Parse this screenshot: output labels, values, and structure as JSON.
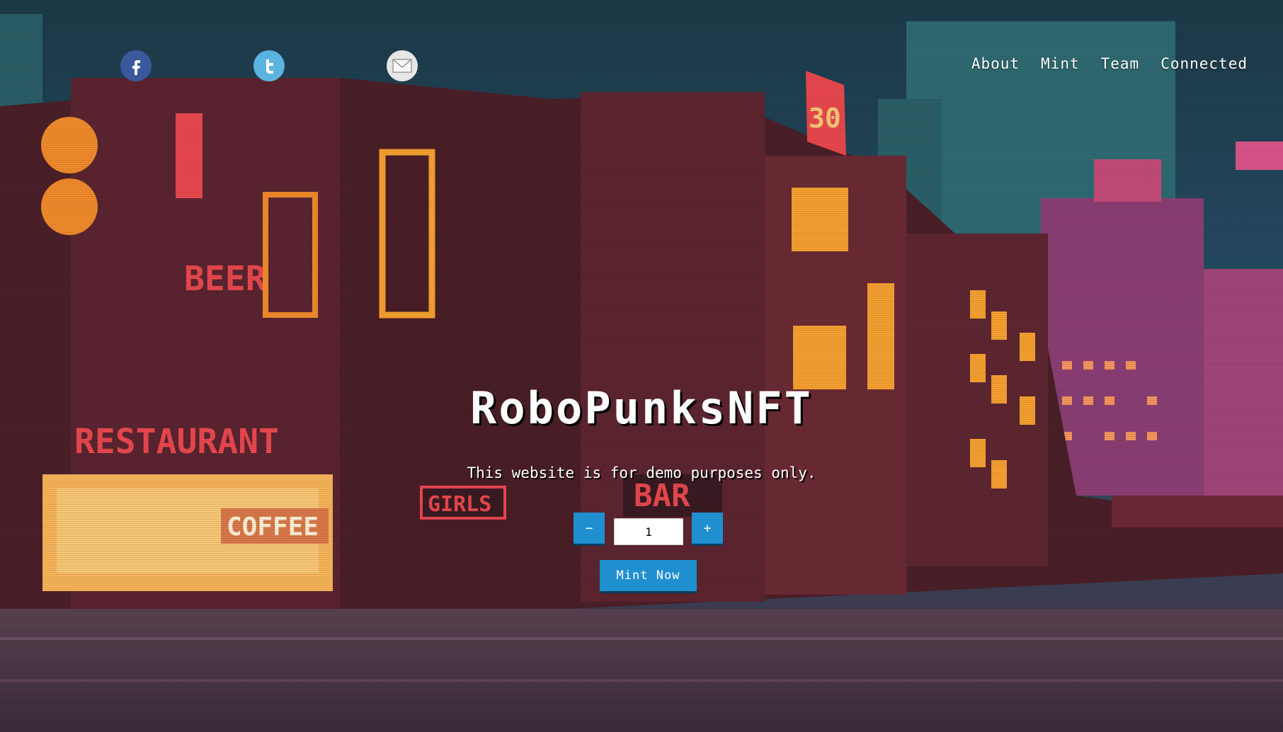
{
  "social": [
    {
      "name": "facebook",
      "icon": "facebook-icon"
    },
    {
      "name": "twitter",
      "icon": "twitter-icon"
    },
    {
      "name": "email",
      "icon": "email-icon"
    }
  ],
  "nav": {
    "about": "About",
    "mint": "Mint",
    "team": "Team",
    "connected": "Connected"
  },
  "hero": {
    "title": "RoboPunksNFT",
    "subtitle": "This website is for demo purposes only."
  },
  "mint": {
    "decrement_label": "−",
    "increment_label": "+",
    "quantity": "1",
    "button_label": "Mint Now"
  },
  "background": {
    "description_signs": [
      "BEER",
      "RESTAURANT",
      "COFFEE",
      "GIRLS",
      "BAR",
      "30"
    ]
  },
  "colors": {
    "button": "#1f8fd0",
    "facebook": "#3a589b",
    "twitter": "#5bb3e0",
    "email": "#e6e6e6"
  }
}
